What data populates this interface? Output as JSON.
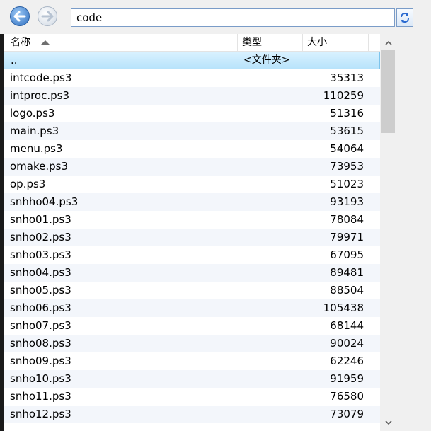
{
  "address": {
    "path": "code"
  },
  "columns": {
    "name": "名称",
    "type": "类型",
    "size": "大小"
  },
  "parent_row": {
    "name": "..",
    "type": "<文件夹>"
  },
  "files": [
    {
      "name": "intcode.ps3",
      "size": "35313"
    },
    {
      "name": "intproc.ps3",
      "size": "110259"
    },
    {
      "name": "logo.ps3",
      "size": "51316"
    },
    {
      "name": "main.ps3",
      "size": "53615"
    },
    {
      "name": "menu.ps3",
      "size": "54064"
    },
    {
      "name": "omake.ps3",
      "size": "73953"
    },
    {
      "name": "op.ps3",
      "size": "51023"
    },
    {
      "name": "snhho04.ps3",
      "size": "93193"
    },
    {
      "name": "snho01.ps3",
      "size": "78084"
    },
    {
      "name": "snho02.ps3",
      "size": "79971"
    },
    {
      "name": "snho03.ps3",
      "size": "67095"
    },
    {
      "name": "snho04.ps3",
      "size": "89481"
    },
    {
      "name": "snho05.ps3",
      "size": "88504"
    },
    {
      "name": "snho06.ps3",
      "size": "105438"
    },
    {
      "name": "snho07.ps3",
      "size": "68144"
    },
    {
      "name": "snho08.ps3",
      "size": "90024"
    },
    {
      "name": "snho09.ps3",
      "size": "62246"
    },
    {
      "name": "snho10.ps3",
      "size": "91959"
    },
    {
      "name": "snho11.ps3",
      "size": "76580"
    },
    {
      "name": "snho12.ps3",
      "size": "73079"
    }
  ],
  "icons": {
    "back": "back-arrow-icon",
    "forward": "forward-arrow-icon",
    "refresh": "refresh-icon",
    "sort": "sort-ascending-icon",
    "scroll_up": "scroll-up-icon",
    "scroll_down": "scroll-down-icon"
  },
  "colors": {
    "accent": "#2e6fc0",
    "selection": "#cfeeff",
    "row_alt": "#f3f6fb"
  }
}
